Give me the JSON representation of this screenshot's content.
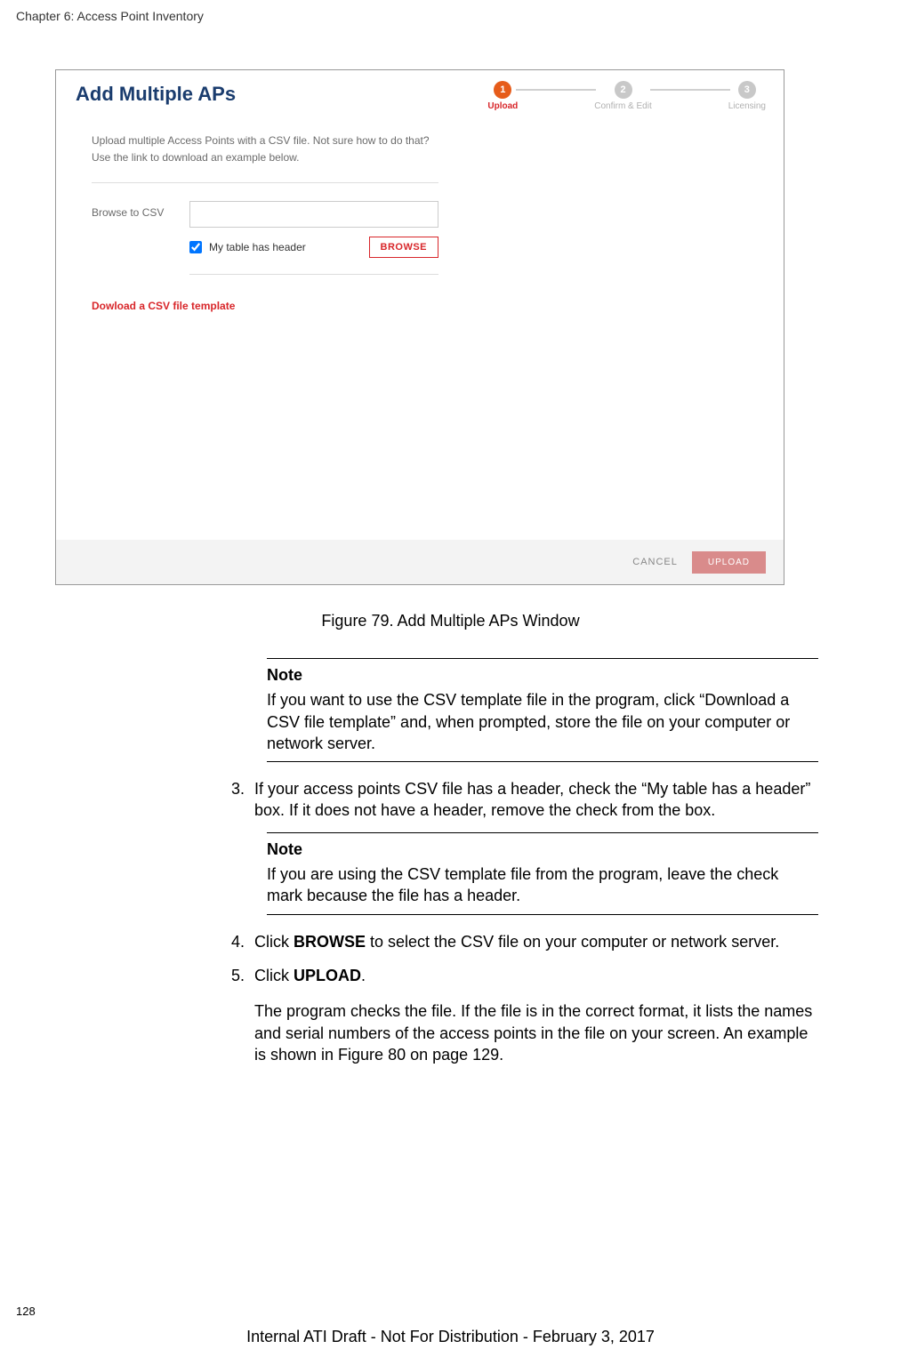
{
  "header": {
    "chapter": "Chapter 6: Access Point Inventory"
  },
  "dialog": {
    "title": "Add Multiple APs",
    "wizard": {
      "steps": [
        {
          "num": "1",
          "label": "Upload",
          "active": true
        },
        {
          "num": "2",
          "label": "Confirm & Edit",
          "active": false
        },
        {
          "num": "3",
          "label": "Licensing",
          "active": false
        }
      ]
    },
    "description": "Upload multiple Access Points with a CSV file. Not sure how to do that? Use the link to download an example below.",
    "browse_label": "Browse to CSV",
    "checkbox_label": "My table has header",
    "browse_button": "BROWSE",
    "download_link": "Dowload a CSV file template",
    "footer": {
      "cancel": "CANCEL",
      "upload": "UPLOAD"
    }
  },
  "figure": {
    "caption": "Figure 79. Add Multiple APs Window"
  },
  "notes": {
    "heading": "Note",
    "note1": "If you want to use the CSV template file in the program, click “Download a CSV file template” and, when prompted, store the file on your computer or network server.",
    "note2": "If you are using the CSV template file from the program, leave the check mark because the file has a header."
  },
  "steps": {
    "s3_num": "3.",
    "s3": "If your access points CSV file has a header, check the “My table has a header” box. If it does not have a header, remove the check from the box.",
    "s4_num": "4.",
    "s4_pre": "Click ",
    "s4_bold": "BROWSE",
    "s4_post": " to select the CSV file on your computer or network server.",
    "s5_num": "5.",
    "s5_pre": "Click ",
    "s5_bold": "UPLOAD",
    "s5_post": ".",
    "s5_sub": "The program checks the file. If the file is in the correct format, it lists the names and serial numbers of the access points in the file on your screen. An example is shown in Figure 80 on page 129."
  },
  "page_number": "128",
  "footer": "Internal ATI Draft - Not For Distribution - February 3, 2017"
}
